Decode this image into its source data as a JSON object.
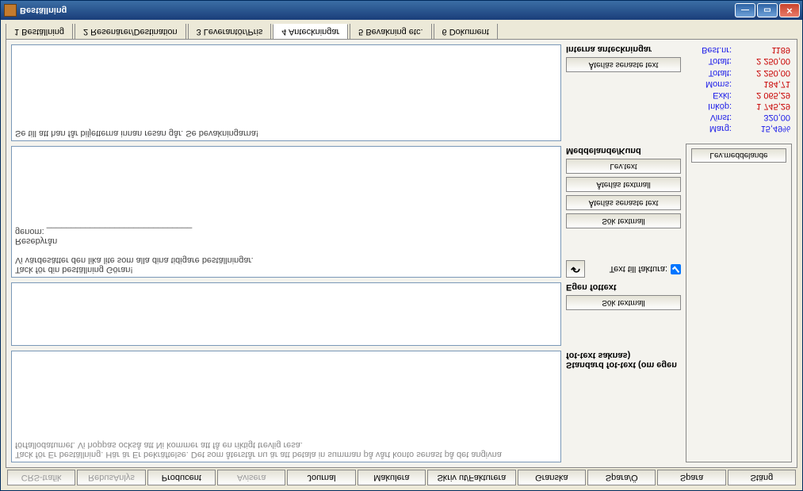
{
  "window": {
    "title": "Beställning"
  },
  "tabs": {
    "t1": "1 Beställning",
    "t2": "2 Resenärer/Destination",
    "t3": "3 Leverantör/Pris",
    "t4": "4 Anteckningar",
    "t5": "5 Bevakning etc.",
    "t6": "6 Dokument"
  },
  "sections": {
    "interna": "Interna anteckningar",
    "meddelande": "Meddelande/Kund",
    "egen_fottext": "Egen fottext",
    "standard_fottext": "Standard fot-text (om egen fot-text saknas)"
  },
  "buttons": {
    "aterlas_senaste": "Återläs senaste text",
    "lev_text": "Lev.text",
    "aterlas_textmall": "Återläs textmall",
    "sok_textmall": "Sök textmall",
    "lev_meddelande": "Lev.meddelande"
  },
  "fakt": {
    "label": "Text till faktura:"
  },
  "memos": {
    "interna": "Se till att han får biljetterna innan resan går. Se bevakningarna!",
    "kund": "Tack för din beställning Göran!\nVi värdesätter den lika lite som alla dina tidigare beställningar.\n\nResebyrån\ngenom: ______________________________",
    "egen": "",
    "standard": "Tack för Er beställning. Här är Er bekräftelse. Det som återstår nu är att betala in summan på vårt konto senast på det angivna\nförfallodatumet. Vi hoppas också att Ni kommer att få en riktigt trevlig resa."
  },
  "summary": {
    "best_nr_lbl": "Best.nr:",
    "best_nr_val": "1189",
    "total1_lbl": "Totalt:",
    "total1_val": "2 250,00",
    "total2_lbl": "Totalt:",
    "total2_val": "2 250,00",
    "moms_lbl": "Moms:",
    "moms_val": "184,71",
    "exkl_lbl": "Exkl:",
    "exkl_val": "2 065,29",
    "inkop_lbl": "Inköp:",
    "inkop_val": "1 745,29",
    "vinst_lbl": "Vinst:",
    "vinst_val": "320,00",
    "marg_lbl": "Marg:",
    "marg_val": "15,49%"
  },
  "toolbar": {
    "crs": "CRS-trafik",
    "rebus": "RebusAnlys",
    "producent": "Producent",
    "avisera": "Avisera",
    "journal": "Journal",
    "makulera": "Makulera",
    "skriv": "Skriv ut/Fakturera",
    "granska": "Granska",
    "sparao": "Spara/Ö",
    "spara": "Spara",
    "stang": "Stäng"
  }
}
